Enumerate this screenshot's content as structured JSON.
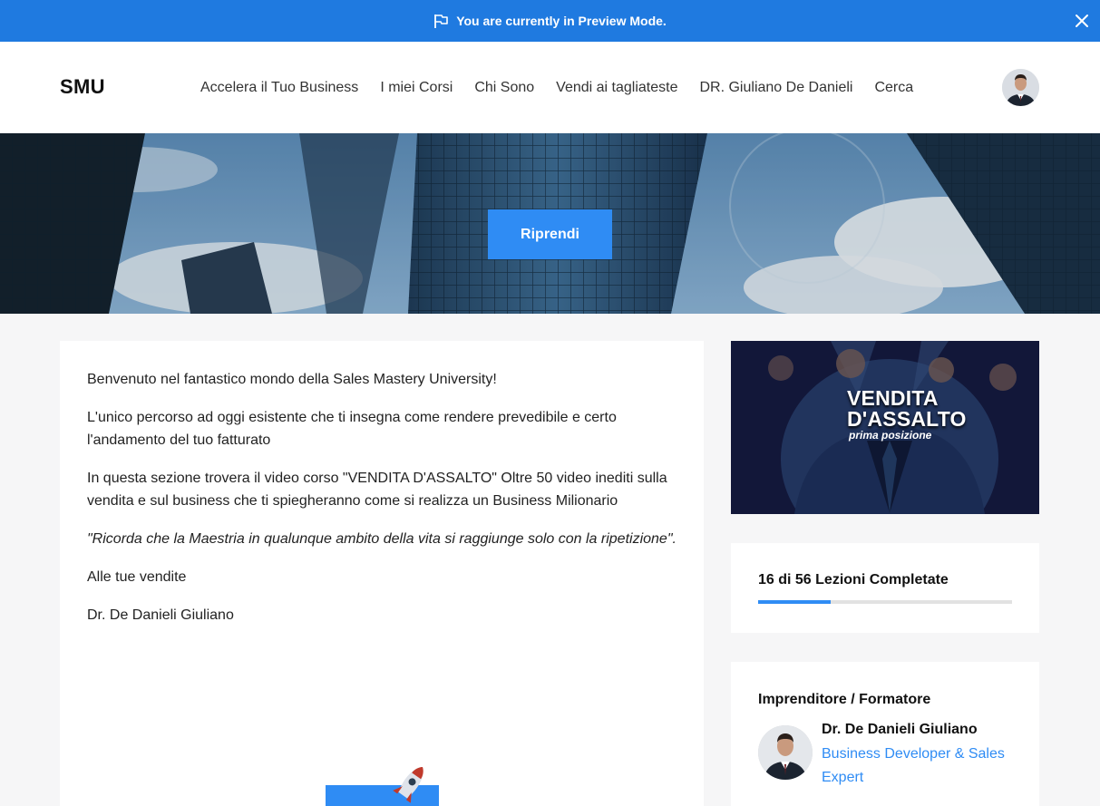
{
  "preview": {
    "message": "You are currently in Preview Mode."
  },
  "navbar": {
    "brand": "SMU",
    "links": [
      "Accelera il Tuo Business",
      "I miei Corsi",
      "Chi Sono",
      "Vendi ai tagliateste",
      "DR. Giuliano De Danieli",
      "Cerca"
    ]
  },
  "hero": {
    "button_label": "Riprendi"
  },
  "content": {
    "paragraphs": [
      "Benvenuto nel fantastico mondo della Sales Mastery University!",
      "L'unico percorso ad oggi esistente che ti insegna come rendere prevedibile e certo l'andamento del tuo fatturato",
      "In questa sezione trovera il video corso \"VENDITA D'ASSALTO\"  Oltre 50 video inediti sulla vendita e sul business che ti spiegheranno come si realizza un Business Milionario",
      "\"Ricorda che la Maestria in qualunque ambito della vita si raggiunge solo con la ripetizione\".",
      "Alle tue vendite",
      "Dr. De Danieli Giuliano"
    ]
  },
  "course_image": {
    "title_line1": "VENDITA",
    "title_line2": "D'ASSALTO",
    "subtitle": "prima posizione"
  },
  "progress": {
    "label": "16 di 56 Lezioni Completate",
    "completed": 16,
    "total": 56,
    "fill_color": "#2f8cf4"
  },
  "author": {
    "role": "Imprenditore / Formatore",
    "name": "Dr. De Danieli Giuliano",
    "description": "Business Developer & Sales Expert"
  },
  "colors": {
    "accent": "#2f8cf4",
    "preview_bar": "#1f7ae0"
  }
}
